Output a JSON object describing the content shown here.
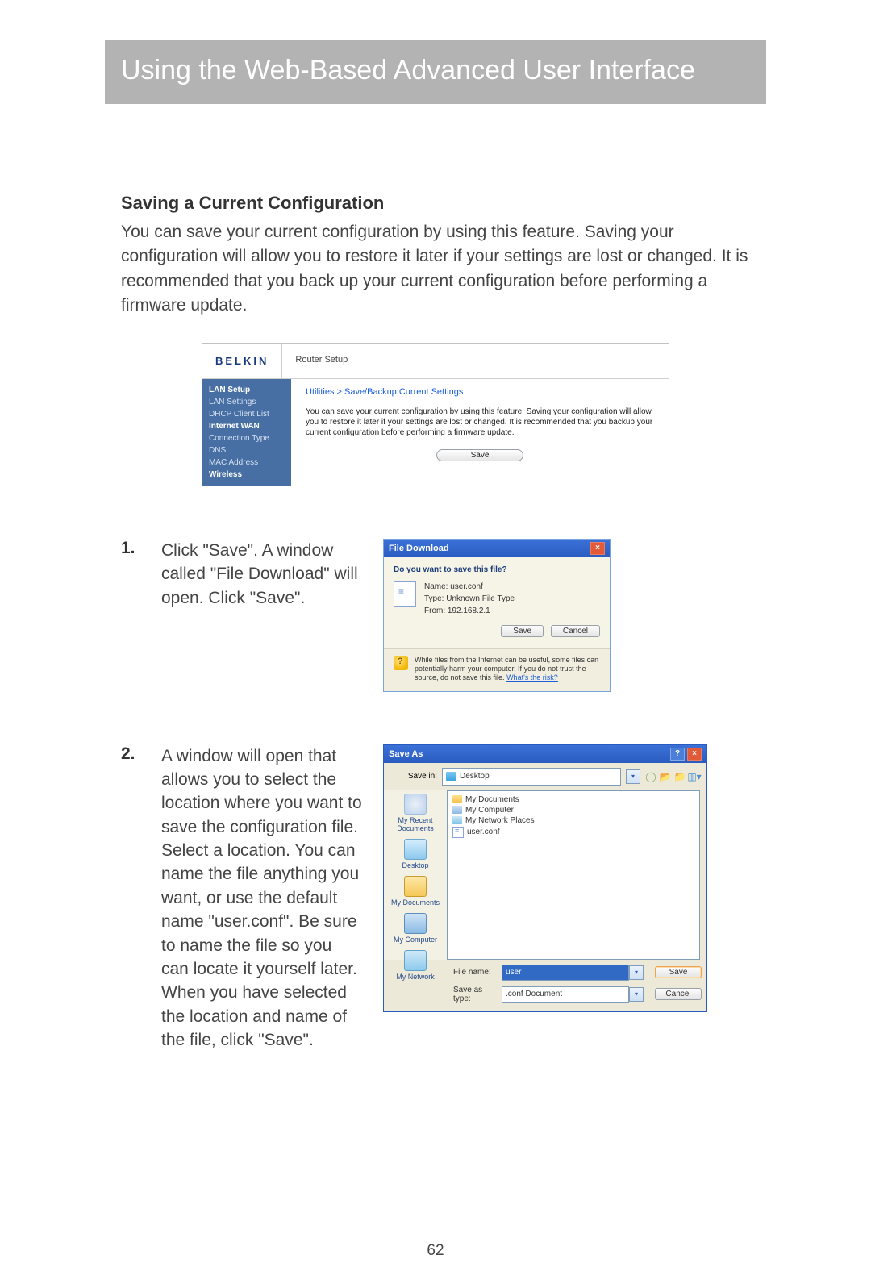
{
  "page_title": "Using the Web-Based Advanced User Interface",
  "section_heading": "Saving a Current Configuration",
  "intro_text": "You can save your current configuration by using this feature. Saving your configuration will allow you to restore it later if your settings are lost or changed. It is recommended that you back up your current configuration before performing a firmware update.",
  "router": {
    "brand": "BELKIN",
    "header_title": "Router Setup",
    "sidebar": {
      "lan_setup": "LAN Setup",
      "lan_settings": "LAN Settings",
      "dhcp_client_list": "DHCP Client List",
      "internet_wan": "Internet WAN",
      "connection_type": "Connection Type",
      "dns": "DNS",
      "mac_address": "MAC Address",
      "wireless": "Wireless"
    },
    "breadcrumb": "Utilities > Save/Backup Current Settings",
    "description": "You can save your current configuration by using this feature. Saving your configuration will allow you to restore it later if your settings are lost or changed. It is recommended that you backup your current configuration before performing a firmware update.",
    "save_btn": "Save"
  },
  "step1": {
    "num": "1.",
    "text": "Click \"Save\". A window called \"File Download\" will open. Click \"Save\"."
  },
  "file_download": {
    "title": "File Download",
    "question": "Do you want to save this file?",
    "name_label": "Name:",
    "name_value": "user.conf",
    "type_label": "Type:",
    "type_value": "Unknown File Type",
    "from_label": "From:",
    "from_value": "192.168.2.1",
    "save_btn": "Save",
    "cancel_btn": "Cancel",
    "warning_text": "While files from the Internet can be useful, some files can potentially harm your computer. If you do not trust the source, do not save this file. ",
    "warning_link": "What's the risk?"
  },
  "step2": {
    "num": "2.",
    "text": "A window will open that allows you to select the location where you want to save the configuration file. Select a location. You can name the file anything you want, or use the default name \"user.conf\". Be sure to name the file so you can locate it yourself later. When you have selected the location and name of the file, click \"Save\"."
  },
  "save_as": {
    "title": "Save As",
    "savein_label": "Save in:",
    "savein_value": "Desktop",
    "places": {
      "recent": "My Recent Documents",
      "desktop": "Desktop",
      "mydocs": "My Documents",
      "mycomp": "My Computer",
      "mynet": "My Network"
    },
    "items": {
      "mydocs": "My Documents",
      "mycomp": "My Computer",
      "mynetplaces": "My Network Places",
      "userconf": "user.conf"
    },
    "filename_label": "File name:",
    "filename_value": "user",
    "saveastype_label": "Save as type:",
    "saveastype_value": ".conf Document",
    "save_btn": "Save",
    "cancel_btn": "Cancel"
  },
  "page_number": "62"
}
